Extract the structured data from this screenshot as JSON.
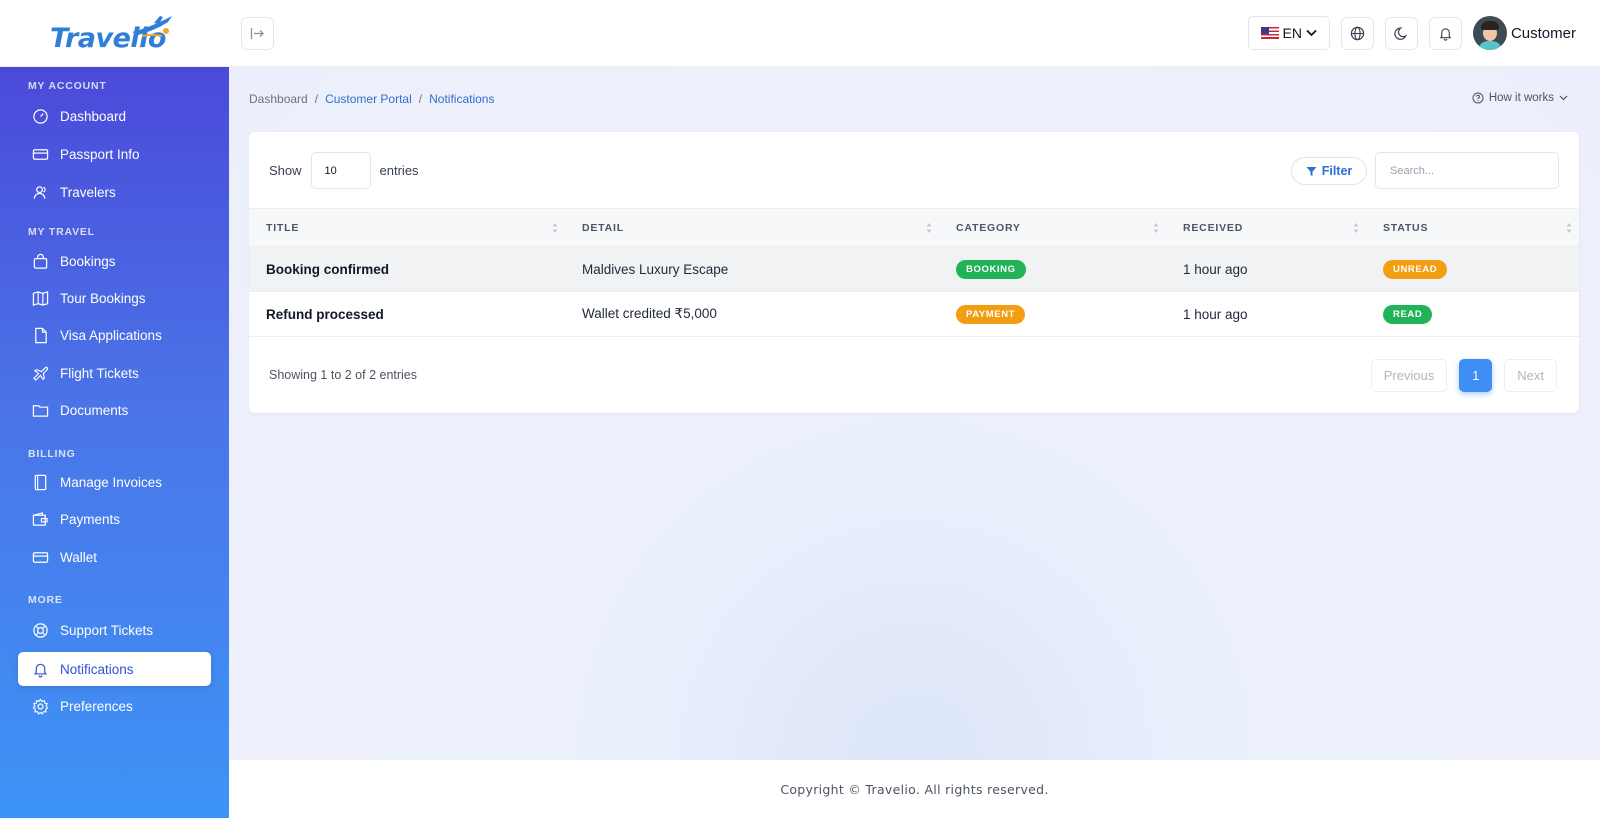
{
  "brand": {
    "name": "Travelio"
  },
  "header": {
    "language": "EN",
    "user_name": "Customer"
  },
  "sidebar": {
    "sections": [
      {
        "title": "MY ACCOUNT"
      },
      {
        "title": "MY TRAVEL"
      },
      {
        "title": "BILLING"
      },
      {
        "title": "MORE"
      }
    ],
    "items": [
      {
        "label": "Dashboard",
        "icon": "gauge-icon"
      },
      {
        "label": "Passport Info",
        "icon": "card-icon"
      },
      {
        "label": "Travelers",
        "icon": "users-icon"
      },
      {
        "label": "Bookings",
        "icon": "bag-icon"
      },
      {
        "label": "Tour Bookings",
        "icon": "map-icon"
      },
      {
        "label": "Visa Applications",
        "icon": "file-icon"
      },
      {
        "label": "Flight Tickets",
        "icon": "plane-icon"
      },
      {
        "label": "Documents",
        "icon": "folder-icon"
      },
      {
        "label": "Manage Invoices",
        "icon": "book-icon"
      },
      {
        "label": "Payments",
        "icon": "wallet-icon"
      },
      {
        "label": "Wallet",
        "icon": "credit-card-icon"
      },
      {
        "label": "Support Tickets",
        "icon": "lifebuoy-icon"
      },
      {
        "label": "Notifications",
        "icon": "bell-icon",
        "active": true
      },
      {
        "label": "Preferences",
        "icon": "gear-icon"
      }
    ]
  },
  "breadcrumb": {
    "items": [
      "Dashboard",
      "Customer Portal",
      "Notifications"
    ],
    "separator": "/"
  },
  "how_it_works": "How it works",
  "controls": {
    "show_label": "Show",
    "entries_value": "10",
    "entries_label": "entries",
    "filter_label": "Filter",
    "search_placeholder": "Search..."
  },
  "table": {
    "columns": [
      "TITLE",
      "DETAIL",
      "CATEGORY",
      "RECEIVED",
      "STATUS"
    ],
    "rows": [
      {
        "title": "Booking confirmed",
        "detail": "Maldives Luxury Escape",
        "category": "BOOKING",
        "received": "1 hour ago",
        "status": "UNREAD"
      },
      {
        "title": "Refund processed",
        "detail": "Wallet credited ₹5,000",
        "category": "PAYMENT",
        "received": "1 hour ago",
        "status": "READ"
      }
    ]
  },
  "pagination": {
    "summary": "Showing 1 to 2 of 2 entries",
    "previous": "Previous",
    "current_page": "1",
    "next": "Next"
  },
  "footer": {
    "copyright": "Copyright © Travelio. All rights reserved."
  },
  "colors": {
    "accent": "#3e8ef3",
    "badge_green": "#22b358",
    "badge_orange": "#f29d12",
    "sidebar_top": "#4a4ad9",
    "sidebar_bottom": "#3e94f6"
  }
}
